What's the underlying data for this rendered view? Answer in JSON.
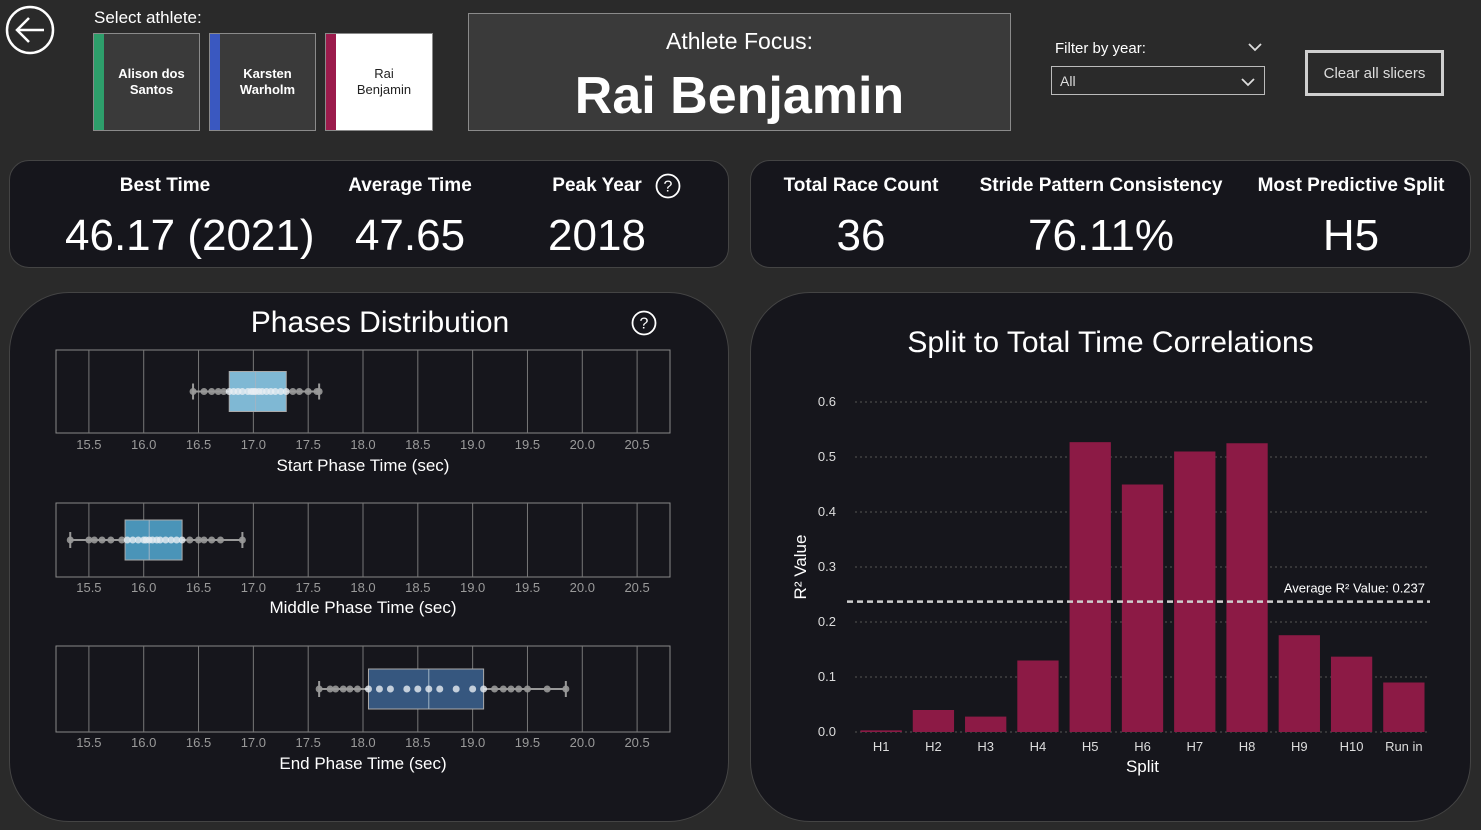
{
  "header": {
    "select_label": "Select athlete:",
    "athletes": [
      {
        "label": "Alison dos\nSantos",
        "color": "#2e9e6b",
        "selected": false
      },
      {
        "label": "Karsten\nWarholm",
        "color": "#3a58c0",
        "selected": false
      },
      {
        "label": "Rai\nBenjamin",
        "color": "#9b1b4c",
        "selected": true
      }
    ],
    "focus_label": "Athlete Focus:",
    "focus_name": "Rai Benjamin",
    "filter_label": "Filter by year:",
    "filter_value": "All",
    "clear_label": "Clear all slicers"
  },
  "kpis_left": [
    {
      "label": "Best Time",
      "value": "46.17 (2021)"
    },
    {
      "label": "Average Time",
      "value": "47.65"
    },
    {
      "label": "Peak Year",
      "value": "2018"
    }
  ],
  "kpis_right": [
    {
      "label": "Total Race Count",
      "value": "36"
    },
    {
      "label": "Stride Pattern Consistency",
      "value": "76.11%"
    },
    {
      "label": "Most Predictive Split",
      "value": "H5"
    }
  ],
  "phases": {
    "title": "Phases Distribution",
    "x_ticks": [
      "15.5",
      "16.0",
      "16.5",
      "17.0",
      "17.5",
      "18.0",
      "18.5",
      "19.0",
      "19.5",
      "20.0",
      "20.5"
    ],
    "xlim": [
      15.2,
      20.8
    ],
    "plots": [
      {
        "xlabel": "Start Phase Time (sec)",
        "color": "#7fb8d4",
        "whisker_low": 16.45,
        "q1": 16.78,
        "median": 17.02,
        "q3": 17.3,
        "whisker_high": 17.6,
        "points": [
          16.45,
          16.55,
          16.62,
          16.68,
          16.73,
          16.78,
          16.82,
          16.86,
          16.9,
          16.95,
          16.98,
          17.0,
          17.02,
          17.05,
          17.08,
          17.12,
          17.16,
          17.2,
          17.25,
          17.3,
          17.36,
          17.42,
          17.5,
          17.58,
          17.6
        ]
      },
      {
        "xlabel": "Middle Phase Time (sec)",
        "color": "#4a94b8",
        "whisker_low": 15.33,
        "q1": 15.83,
        "median": 16.05,
        "q3": 16.35,
        "whisker_high": 16.9,
        "points": [
          15.33,
          15.5,
          15.55,
          15.62,
          15.7,
          15.8,
          15.85,
          15.9,
          15.95,
          16.0,
          16.02,
          16.05,
          16.08,
          16.12,
          16.15,
          16.2,
          16.25,
          16.3,
          16.35,
          16.42,
          16.5,
          16.55,
          16.62,
          16.7,
          16.9
        ]
      },
      {
        "xlabel": "End Phase Time (sec)",
        "color": "#36577f",
        "whisker_low": 17.6,
        "q1": 18.05,
        "median": 18.6,
        "q3": 19.1,
        "whisker_high": 19.85,
        "points": [
          17.6,
          17.7,
          17.75,
          17.82,
          17.88,
          17.95,
          18.05,
          18.15,
          18.25,
          18.4,
          18.5,
          18.6,
          18.7,
          18.85,
          19.0,
          19.1,
          19.2,
          19.28,
          19.35,
          19.42,
          19.5,
          19.68,
          19.85
        ]
      }
    ]
  },
  "chart_data": {
    "type": "bar",
    "title": "Split to Total Time Correlations",
    "xlabel": "Split",
    "ylabel": "R² Value",
    "categories": [
      "H1",
      "H2",
      "H3",
      "H4",
      "H5",
      "H6",
      "H7",
      "H8",
      "H9",
      "H10",
      "Run in"
    ],
    "values": [
      0.003,
      0.04,
      0.028,
      0.13,
      0.527,
      0.45,
      0.51,
      0.525,
      0.176,
      0.137,
      0.09
    ],
    "ylim": [
      0,
      0.6
    ],
    "y_ticks": [
      "0.0",
      "0.1",
      "0.2",
      "0.3",
      "0.4",
      "0.5",
      "0.6"
    ],
    "bar_color": "#8c1a45",
    "reference_line": {
      "value": 0.237,
      "label": "Average R² Value: 0.237"
    },
    "grid": true
  }
}
